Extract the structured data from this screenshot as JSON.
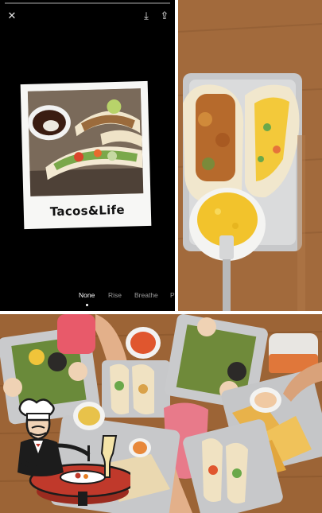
{
  "viewer": {
    "caption": "Tacos&Life",
    "filters": [
      "None",
      "Rise",
      "Breathe",
      "P"
    ],
    "selected_filter": "None",
    "icons": [
      "close-icon",
      "download-icon",
      "share-icon"
    ]
  },
  "icon_glyphs": {
    "close": "✕",
    "download": "⤓",
    "share": "⇪"
  },
  "colors": {
    "viewer_bg": "#000000",
    "table_wood": "#a0673a",
    "tray_metal": "#c9c9c9",
    "logo_table": "#c0392b"
  }
}
